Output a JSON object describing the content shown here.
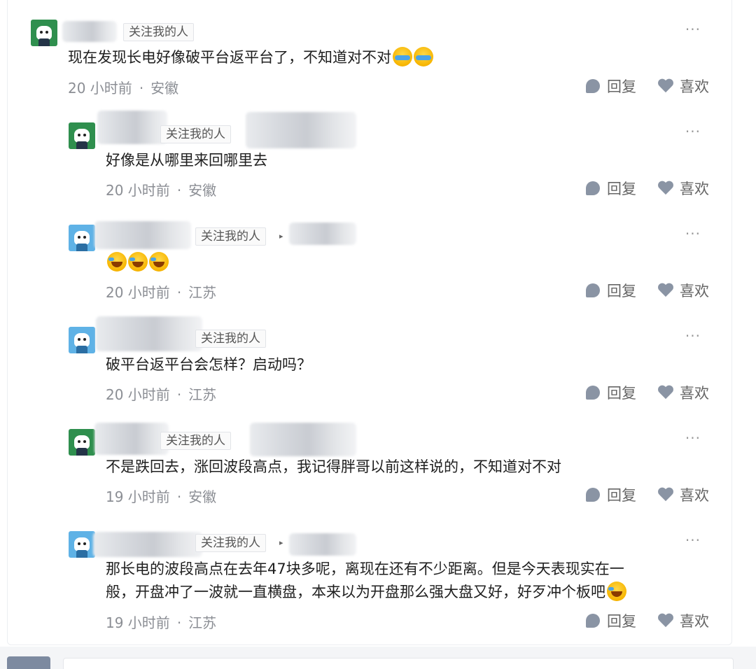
{
  "follow_tag": "关注我的人",
  "more_icon": "more-dots-icon",
  "reply_label": "回复",
  "like_label": "喜欢",
  "comments": [
    {
      "text": "现在发现长电好像破平台返平台了，不知道对不对",
      "time": "20 小时前",
      "location": "安徽",
      "emojis": [
        "tear-emoji",
        "tear-emoji"
      ]
    },
    {
      "text": "好像是从哪里来回哪里去",
      "time": "20 小时前",
      "location": "安徽"
    },
    {
      "text": "",
      "time": "20 小时前",
      "location": "江苏",
      "emojis": [
        "laugh-cry-emoji",
        "laugh-cry-emoji",
        "laugh-cry-emoji"
      ]
    },
    {
      "text": "破平台返平台会怎样？启动吗？",
      "time": "20 小时前",
      "location": "江苏"
    },
    {
      "text": "不是跌回去，涨回波段高点，我记得胖哥以前这样说的，不知道对不对",
      "time": "19 小时前",
      "location": "安徽"
    },
    {
      "text_line1": "那长电的波段高点在去年47块多呢，离现在还有不少距离。但是今天表现实在一",
      "text_line2": "般，开盘冲了一波就一直横盘，本来以为开盘那么强大盘又好，好歹冲个板吧",
      "time": "19 小时前",
      "location": "江苏",
      "emojis": [
        "laugh-cry-emoji"
      ]
    }
  ],
  "separator": "·"
}
